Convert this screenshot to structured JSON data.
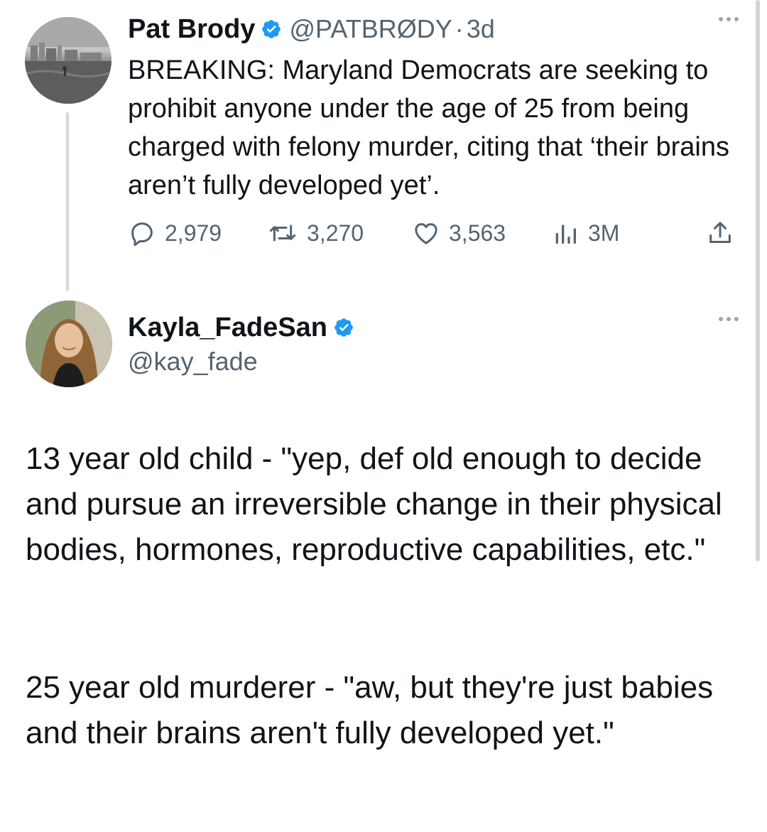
{
  "tweet1": {
    "name": "Pat Brody",
    "handle": "@PATBRØDY",
    "separator": "·",
    "time": "3d",
    "text": "BREAKING: Maryland Democrats are seeking to prohibit anyone under the age of 25 from being charged with felony murder, citing that ‘their brains aren’t fully developed yet’.",
    "stats": {
      "replies": "2,979",
      "retweets": "3,270",
      "likes": "3,563",
      "views": "3M"
    },
    "icons": [
      "reply-icon",
      "retweet-icon",
      "like-icon",
      "views-icon",
      "share-icon",
      "more-icon",
      "verified-badge-icon"
    ]
  },
  "tweet2": {
    "name": "Kayla_FadeSan",
    "handle": "@kay_fade",
    "paragraphs": [
      "13 year old child - \"yep, def old enough to decide and pursue an irreversible change in their physical bodies, hormones, reproductive capabilities, etc.\"",
      "25 year old murderer - \"aw, but they're just babies and their brains aren't fully developed yet.\""
    ]
  },
  "colors": {
    "text": "#0f1419",
    "secondary": "#536471",
    "verified": "#1d9bf0",
    "thread_line": "#cfd9de"
  }
}
